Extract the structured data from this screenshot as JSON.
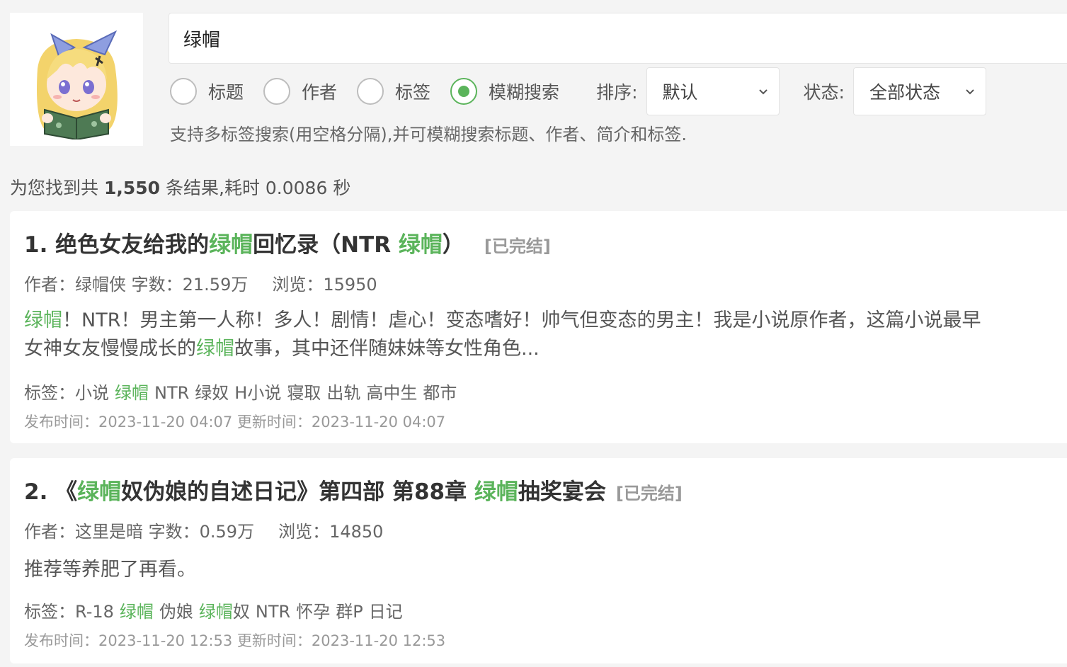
{
  "search": {
    "query": "绿帽"
  },
  "options": {
    "radios": [
      {
        "label": "标题",
        "checked": false
      },
      {
        "label": "作者",
        "checked": false
      },
      {
        "label": "标签",
        "checked": false
      },
      {
        "label": "模糊搜索",
        "checked": true
      }
    ],
    "sort_label": "排序:",
    "sort_value": "默认",
    "status_label": "状态:",
    "status_value": "全部状态"
  },
  "hint": "支持多标签搜索(用空格分隔),并可模糊搜索标题、作者、简介和标签.",
  "results_summary": {
    "prefix": "为您找到共",
    "count": "1,550",
    "suffix": "条结果,耗时 0.0086 秒"
  },
  "accent_color": "#5bb45b",
  "results": [
    {
      "index": "1.",
      "title_parts": [
        {
          "text": "绝色女友给我的",
          "hl": false
        },
        {
          "text": "绿帽",
          "hl": true
        },
        {
          "text": "回忆录（NTR ",
          "hl": false
        },
        {
          "text": "绿帽",
          "hl": true
        },
        {
          "text": "）",
          "hl": false
        }
      ],
      "status": "[已完结]",
      "author": "作者：绿帽侠 字数：21.59万",
      "views": "浏览：15950",
      "desc_line1": [
        {
          "text": "绿帽",
          "hl": true
        },
        {
          "text": "！NTR！男主第一人称！多人！剧情！虐心！变态嗜好！帅气但变态的男主！我是小说原作者，这篇小说最早",
          "hl": false
        }
      ],
      "desc_line2": [
        {
          "text": "女神女友慢慢成长的",
          "hl": false
        },
        {
          "text": "绿帽",
          "hl": true
        },
        {
          "text": "故事，其中还伴随妹妹等女性角色...",
          "hl": false
        }
      ],
      "tags_label": "标签：",
      "tags": [
        {
          "text": "小说",
          "hl": false
        },
        {
          "text": "绿帽",
          "hl": true
        },
        {
          "text": "NTR",
          "hl": false
        },
        {
          "text": "绿奴",
          "hl": false
        },
        {
          "text": "H小说",
          "hl": false
        },
        {
          "text": "寝取",
          "hl": false
        },
        {
          "text": "出轨",
          "hl": false
        },
        {
          "text": "高中生",
          "hl": false
        },
        {
          "text": "都市",
          "hl": false
        }
      ],
      "dates": "发布时间：2023-11-20 04:07 更新时间：2023-11-20 04:07"
    },
    {
      "index": "2.",
      "title_parts": [
        {
          "text": "《",
          "hl": false
        },
        {
          "text": "绿帽",
          "hl": true
        },
        {
          "text": "奴伪娘的自述日记》第四部 第88章 ",
          "hl": false
        },
        {
          "text": "绿帽",
          "hl": true
        },
        {
          "text": "抽奖宴会",
          "hl": false
        }
      ],
      "status": "[已完结]",
      "author": "作者：这里是暗 字数：0.59万",
      "views": "浏览：14850",
      "desc": "推荐等养肥了再看。",
      "tags_label": "标签：",
      "tags": [
        {
          "text": "R-18",
          "hl": false
        },
        {
          "text": "绿帽",
          "hl": true
        },
        {
          "text": "伪娘",
          "hl": false
        },
        {
          "text": "绿帽",
          "hl": true,
          "suffix": "奴"
        },
        {
          "text": "NTR",
          "hl": false
        },
        {
          "text": "怀孕",
          "hl": false
        },
        {
          "text": "群P",
          "hl": false
        },
        {
          "text": "日记",
          "hl": false
        }
      ],
      "dates": "发布时间：2023-11-20 12:53 更新时间：2023-11-20 12:53"
    }
  ]
}
